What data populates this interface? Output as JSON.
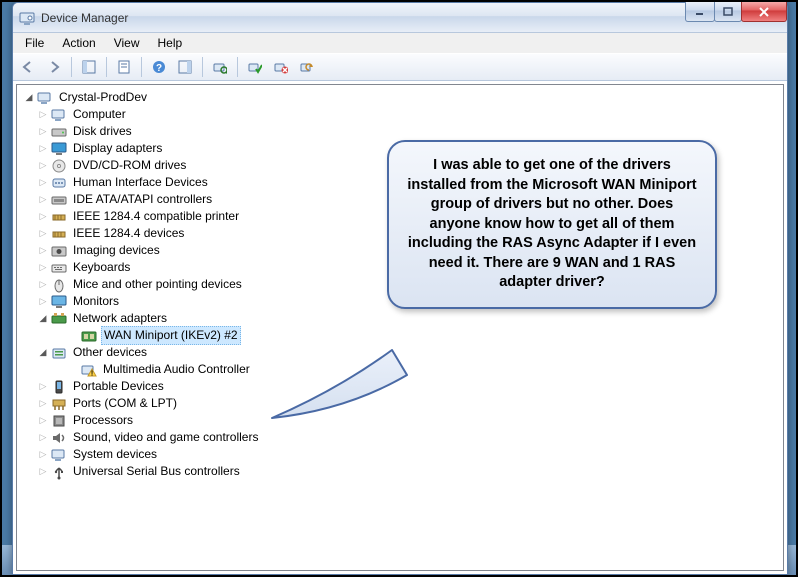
{
  "window": {
    "title": "Device Manager"
  },
  "menu": {
    "file": "File",
    "action": "Action",
    "view": "View",
    "help": "Help"
  },
  "tree": {
    "root": "Crystal-ProdDev",
    "items": [
      "Computer",
      "Disk drives",
      "Display adapters",
      "DVD/CD-ROM drives",
      "Human Interface Devices",
      "IDE ATA/ATAPI controllers",
      "IEEE 1284.4 compatible printer",
      "IEEE 1284.4 devices",
      "Imaging devices",
      "Keyboards",
      "Mice and other pointing devices",
      "Monitors",
      "Network adapters",
      "Other devices",
      "Portable Devices",
      "Ports (COM & LPT)",
      "Processors",
      "Sound, video and game controllers",
      "System devices",
      "Universal Serial Bus controllers"
    ],
    "network_child": "WAN Miniport (IKEv2) #2",
    "other_child": "Multimedia Audio Controller"
  },
  "callout": {
    "text": "I was able to get one of the drivers installed from the Microsoft WAN Miniport group of drivers but no other. Does anyone know how to get all of them including the RAS Async Adapter if I even need it. There are 9 WAN and 1 RAS adapter driver?"
  }
}
